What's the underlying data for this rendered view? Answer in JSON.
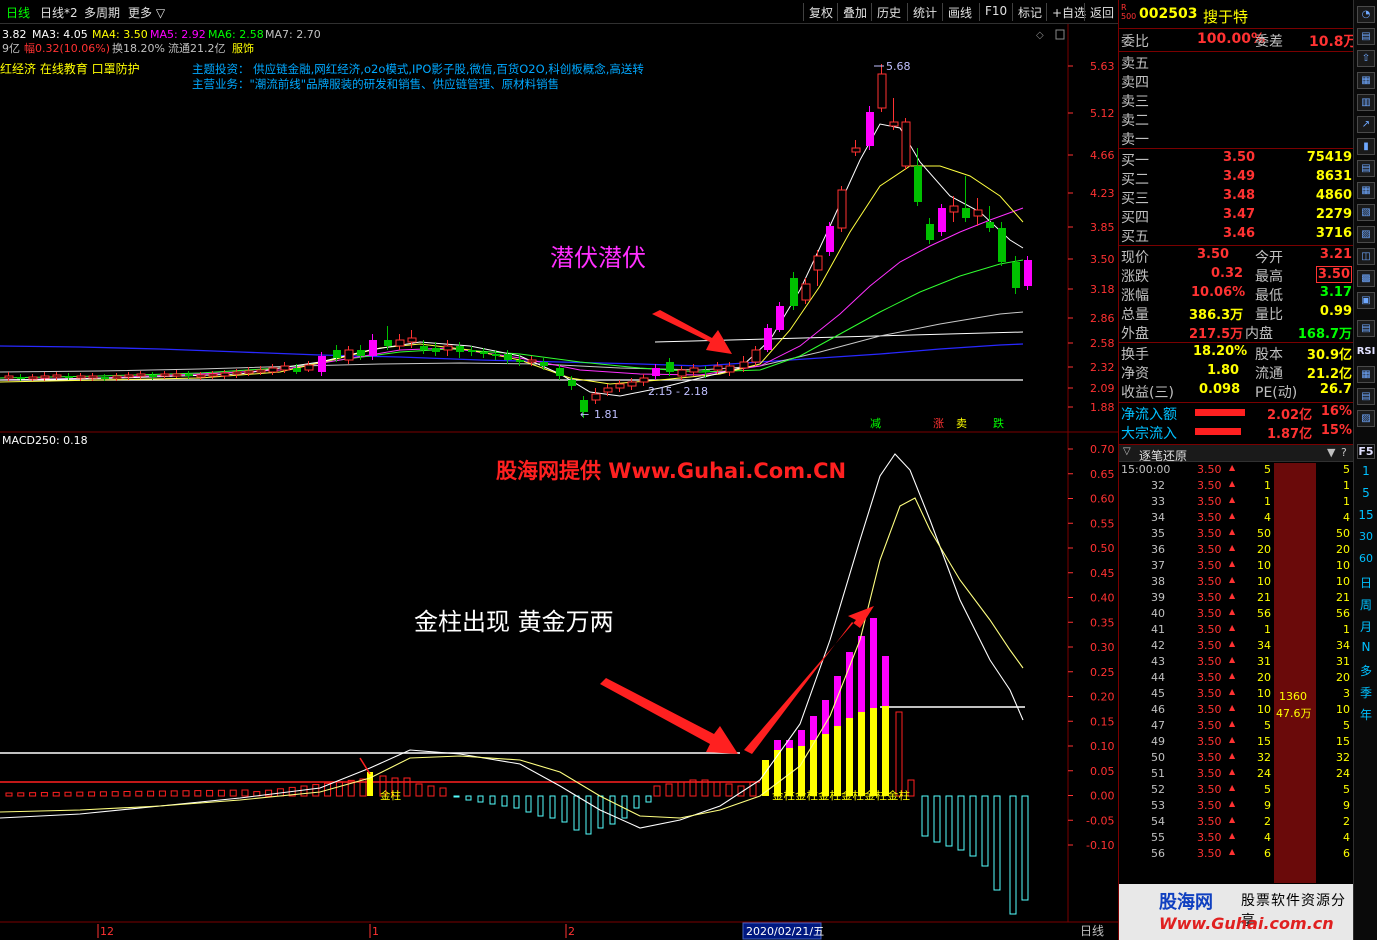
{
  "colors": {
    "up": "#ff3232",
    "down": "#00c000",
    "magenta": "#ff00ff",
    "yellow": "#ffff00",
    "cyan": "#54ffff",
    "white": "#ffffff",
    "blue": "#2020ff",
    "green": "#00ff00"
  },
  "topbar": {
    "period": "日线",
    "indicator": "日线*2",
    "multi_period": "多周期",
    "more": "更多",
    "buttons": [
      "复权",
      "叠加",
      "历史",
      "统计",
      "画线",
      "F10",
      "标记",
      "+自选",
      "返回"
    ]
  },
  "ma_line": {
    "ma2_partial": "3.82",
    "ma3": "MA3: 4.05",
    "ma4": "MA4: 3.50",
    "ma5": "MA5: 2.92",
    "ma6": "MA6: 2.58",
    "ma7": "MA7: 2.70"
  },
  "info_line": {
    "volume_partial": "9亿",
    "change": "幅0.32(10.06%)",
    "turnover": "换18.20%",
    "float": "流通21.2亿",
    "industry": "服饰"
  },
  "concepts_left": "红经济 在线教育 口罩防护",
  "theme": "主题投资：   供应链金融,网红经济,o2o模式,IPO影子股,微信,百货O2O,科创板概念,高送转",
  "business": "主营业务：\"潮流前线\"品牌服装的研发和销售、供应链管理、原材料销售",
  "annotations": {
    "lurk": "潜伏潜伏",
    "gold_bars": "金柱出现  黄金万两",
    "watermark": "股海网提供 Www.Guhai.Com.CN",
    "high_label": "5.68",
    "low_label": "1.81",
    "range_label": "2.15 - 2.18",
    "gold_small": "金柱",
    "gold_series": "金柱金柱金柱金柱金柱金柱",
    "sig_reduce": "减",
    "sig_up": "涨",
    "sig_sell": "卖",
    "sig_down": "跌"
  },
  "macd_title": "MACD250: 0.18",
  "price_axis": [
    "5.63",
    "5.12",
    "4.66",
    "4.23",
    "3.85",
    "3.50",
    "3.18",
    "2.86",
    "2.58",
    "2.32",
    "2.09",
    "1.88"
  ],
  "macd_axis": [
    "0.70",
    "0.65",
    "0.60",
    "0.55",
    "0.50",
    "0.45",
    "0.40",
    "0.35",
    "0.30",
    "0.25",
    "0.20",
    "0.15",
    "0.10",
    "0.05",
    "0.00",
    "-0.05",
    "-0.10"
  ],
  "date_axis": {
    "d12": "12",
    "d1": "1",
    "d2": "2",
    "current": "2020/02/21/五",
    "period": "日线"
  },
  "stock": {
    "code": "002503",
    "name": "搜于特",
    "badge_r": "R",
    "badge_500": "500"
  },
  "orderbook": {
    "webi_label": "委比",
    "webi": "100.00%",
    "weicha_label": "委差",
    "weicha": "10.8万",
    "sells": [
      {
        "label": "卖五",
        "price": "",
        "vol": ""
      },
      {
        "label": "卖四",
        "price": "",
        "vol": ""
      },
      {
        "label": "卖三",
        "price": "",
        "vol": ""
      },
      {
        "label": "卖二",
        "price": "",
        "vol": ""
      },
      {
        "label": "卖一",
        "price": "",
        "vol": ""
      }
    ],
    "buys": [
      {
        "label": "买一",
        "price": "3.50",
        "vol": "75419"
      },
      {
        "label": "买二",
        "price": "3.49",
        "vol": "8631"
      },
      {
        "label": "买三",
        "price": "3.48",
        "vol": "4860"
      },
      {
        "label": "买四",
        "price": "3.47",
        "vol": "2279"
      },
      {
        "label": "买五",
        "price": "3.46",
        "vol": "3716"
      }
    ]
  },
  "quote": {
    "rows": [
      {
        "l1": "现价",
        "v1": "3.50",
        "l2": "今开",
        "v2": "3.21"
      },
      {
        "l1": "涨跌",
        "v1": "0.32",
        "l2": "最高",
        "v2": "3.50"
      },
      {
        "l1": "涨幅",
        "v1": "10.06%",
        "l2": "最低",
        "v2": "3.17"
      },
      {
        "l1": "总量",
        "v1": "386.3万",
        "l2": "量比",
        "v2": "0.99"
      },
      {
        "l1": "外盘",
        "v1": "217.5万",
        "l2": "内盘",
        "v2": "168.7万"
      }
    ],
    "rows2": [
      {
        "l1": "换手",
        "v1": "18.20%",
        "l2": "股本",
        "v2": "30.9亿"
      },
      {
        "l1": "净资",
        "v1": "1.80",
        "l2": "流通",
        "v2": "21.2亿"
      },
      {
        "l1": "收益(三)",
        "v1": "0.098",
        "l2": "PE(动)",
        "v2": "26.7"
      }
    ],
    "flows": [
      {
        "label": "净流入额",
        "value": "2.02亿",
        "pct": "16%"
      },
      {
        "label": "大宗流入",
        "value": "1.87亿",
        "pct": "15%"
      }
    ]
  },
  "ticks_header": "逐笔还原",
  "ticks": [
    {
      "t": "15:00:00",
      "p": "3.50",
      "v": "5",
      "r": "5"
    },
    {
      "t": "32",
      "p": "3.50",
      "v": "1",
      "r": "1"
    },
    {
      "t": "33",
      "p": "3.50",
      "v": "1",
      "r": "1"
    },
    {
      "t": "34",
      "p": "3.50",
      "v": "4",
      "r": "4"
    },
    {
      "t": "35",
      "p": "3.50",
      "v": "50",
      "r": "50"
    },
    {
      "t": "36",
      "p": "3.50",
      "v": "20",
      "r": "20"
    },
    {
      "t": "37",
      "p": "3.50",
      "v": "10",
      "r": "10"
    },
    {
      "t": "38",
      "p": "3.50",
      "v": "10",
      "r": "10"
    },
    {
      "t": "39",
      "p": "3.50",
      "v": "21",
      "r": "21"
    },
    {
      "t": "40",
      "p": "3.50",
      "v": "56",
      "r": "56"
    },
    {
      "t": "41",
      "p": "3.50",
      "v": "1",
      "r": "1"
    },
    {
      "t": "42",
      "p": "3.50",
      "v": "34",
      "r": "34"
    },
    {
      "t": "43",
      "p": "3.50",
      "v": "31",
      "r": "31"
    },
    {
      "t": "44",
      "p": "3.50",
      "v": "20",
      "r": "20"
    },
    {
      "t": "45",
      "p": "3.50",
      "v": "10",
      "r": "3"
    },
    {
      "t": "46",
      "p": "3.50",
      "v": "10",
      "r": "10"
    },
    {
      "t": "47",
      "p": "3.50",
      "v": "5",
      "r": "5"
    },
    {
      "t": "49",
      "p": "3.50",
      "v": "15",
      "r": "15"
    },
    {
      "t": "50",
      "p": "3.50",
      "v": "32",
      "r": "32"
    },
    {
      "t": "51",
      "p": "3.50",
      "v": "24",
      "r": "24"
    },
    {
      "t": "52",
      "p": "3.50",
      "v": "5",
      "r": "5"
    },
    {
      "t": "53",
      "p": "3.50",
      "v": "9",
      "r": "9"
    },
    {
      "t": "54",
      "p": "3.50",
      "v": "2",
      "r": "2"
    },
    {
      "t": "55",
      "p": "3.50",
      "v": "4",
      "r": "4"
    },
    {
      "t": "56",
      "p": "3.50",
      "v": "6",
      "r": "6"
    }
  ],
  "big_order": {
    "count": "1360",
    "pct": "47.6万"
  },
  "footer_logo": {
    "brand": "股海网",
    "slogan": "股票软件资源分享",
    "url": "Www.Guhai.com.cn"
  },
  "right_tabs": [
    "RSI",
    "F5",
    "1",
    "5",
    "15",
    "30",
    "60",
    "日",
    "周",
    "月",
    "N",
    "多",
    "季",
    "年"
  ]
}
